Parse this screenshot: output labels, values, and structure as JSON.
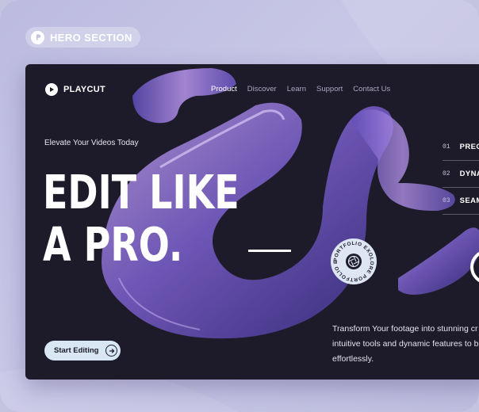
{
  "section_tag": {
    "label": "HERO SECTION",
    "icon": "p-logo-icon"
  },
  "brand": {
    "name": "PLAYCUT",
    "icon": "play-icon"
  },
  "nav": {
    "items": [
      {
        "label": "Product",
        "active": true
      },
      {
        "label": "Discover",
        "active": false
      },
      {
        "label": "Learn",
        "active": false
      },
      {
        "label": "Support",
        "active": false
      },
      {
        "label": "Contact Us",
        "active": false
      }
    ]
  },
  "hero": {
    "eyebrow": "Elevate Your Videos Today",
    "headline_line1": "EDIT LIKE",
    "headline_line2": "A PRO.",
    "badge_text": "PORTFOLIO EXOLORE PORTFOLIO EXOLORE",
    "badge_icon": "aperture-icon",
    "description_line1": "Transform Your footage into stunning cr",
    "description_line2": "intuitive tools and dynamic features to b",
    "description_line3": "effortlessly.",
    "cta_label": "Start Editing",
    "cta_icon": "arrow-right-icon"
  },
  "features": [
    {
      "num": "01",
      "name": "PREC"
    },
    {
      "num": "02",
      "name": "DYNA"
    },
    {
      "num": "03",
      "name": "SEAM"
    }
  ],
  "colors": {
    "page_bg": "#c5c4e0",
    "hero_bg": "#1d1b29",
    "accent_purple": "#8d70dc",
    "cta_bg": "#d9e6f3"
  }
}
